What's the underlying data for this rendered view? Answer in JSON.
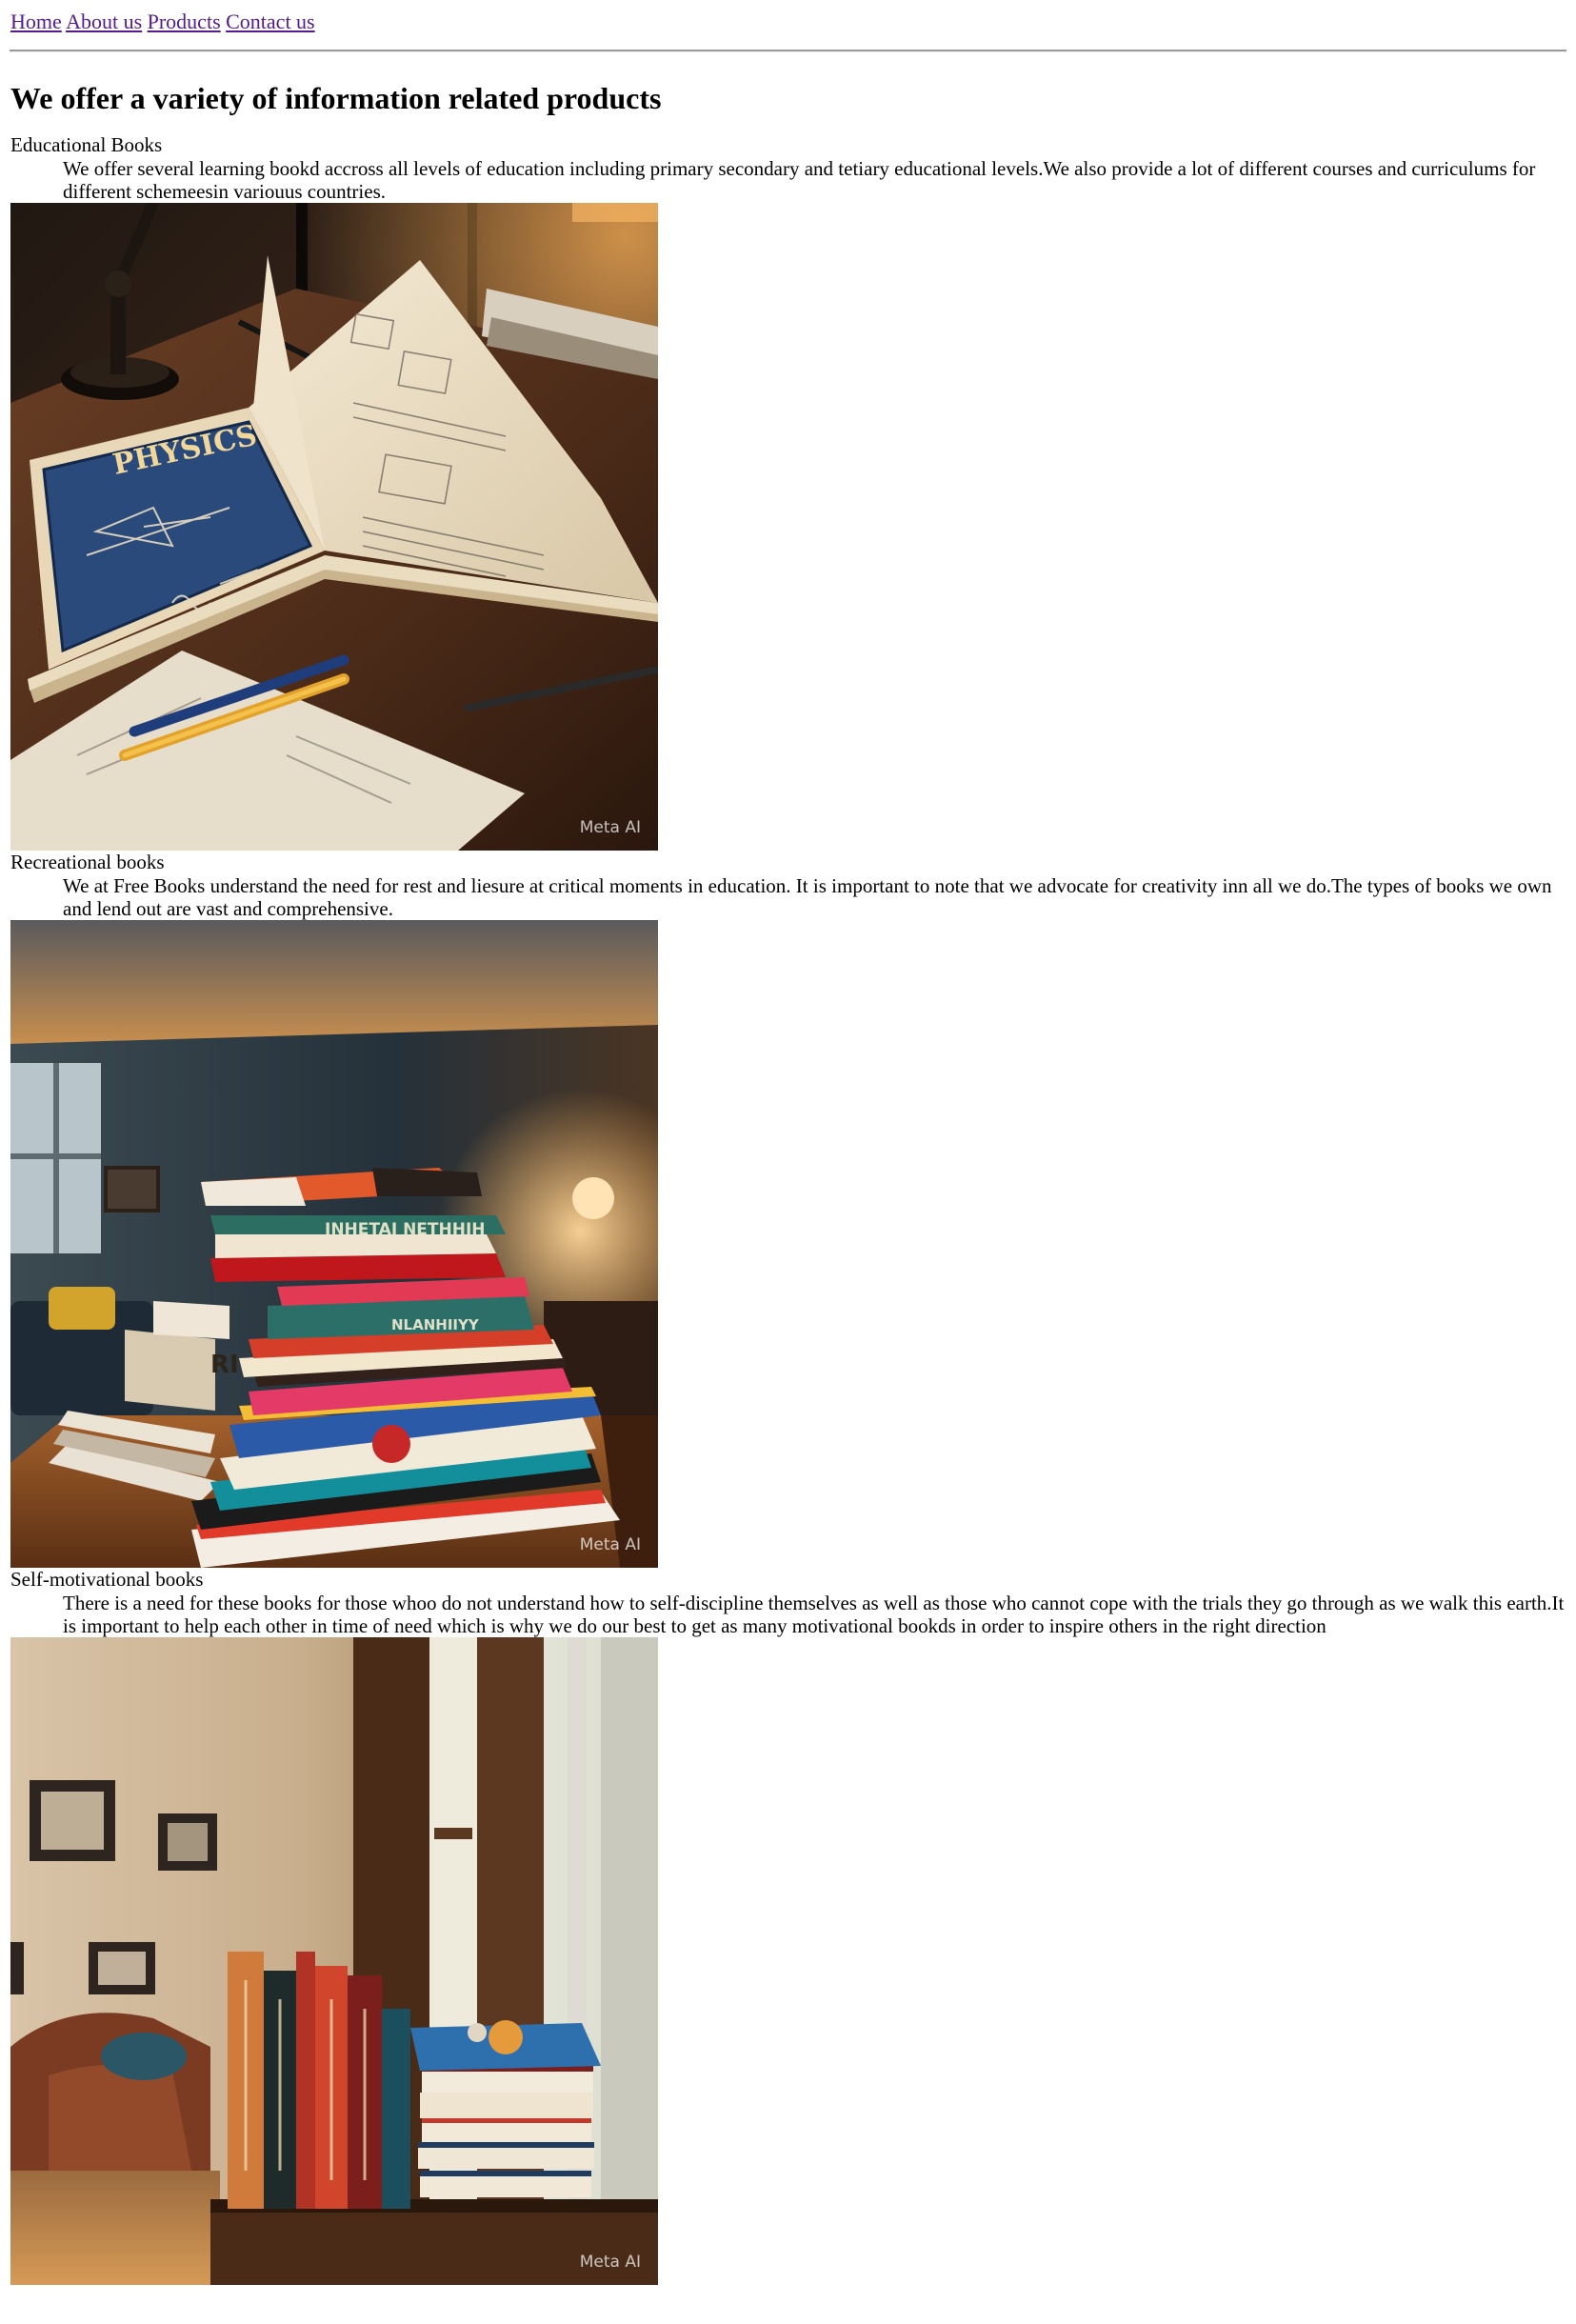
{
  "nav": {
    "links": [
      "Home",
      "About us",
      "Products",
      "Contact us"
    ]
  },
  "page_title": "We offer a variety of information related products",
  "products": [
    {
      "term": "Educational Books",
      "description": "We offer several learning bookd accross all levels of education including primary secondary and tetiary educational levels.We also provide a lot of different courses and curriculums for different schemeesin variouus countries.",
      "image": {
        "subject": "open physics textbook on a desk with lamp and pens",
        "cover_text": "PHYSICS",
        "watermark": "Meta AI"
      }
    },
    {
      "term": "Recreational books",
      "description": "We at Free Books understand the need for rest and liesure at critical moments in education. It is important to note that we advocate for creativity inn all we do.The types of books we own and lend out are vast and comprehensive.",
      "image": {
        "subject": "tall stack of colorful books on a table in a cozy room",
        "watermark": "Meta AI"
      }
    },
    {
      "term": "Self-motivational books",
      "description": "There is a need for these books for those whoo do not understand how to self-discipline themselves as well as those who cannot cope with the trials they go through as we walk this earth.It is important to help each other in time of need which is why we do our best to get as many motivational bookds in order to inspire others in the right direction",
      "image": {
        "subject": "upright books and a small stack on a windowsill beside an armchair",
        "watermark": "Meta AI"
      }
    }
  ],
  "colors": {
    "link": "#551A8B",
    "text": "#000000",
    "background": "#ffffff"
  }
}
